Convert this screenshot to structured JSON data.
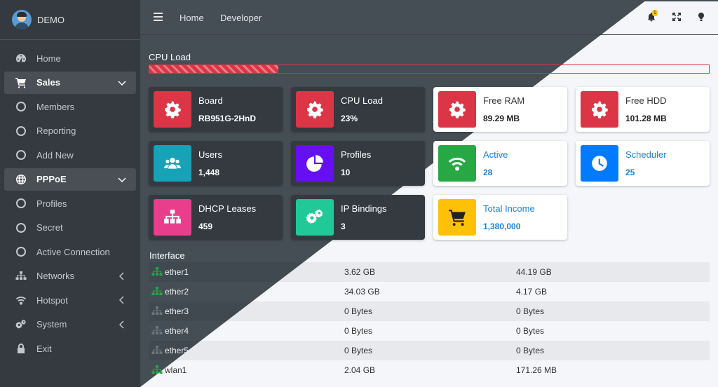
{
  "brand": {
    "name": "DEMO"
  },
  "sidebar": {
    "items": [
      {
        "label": "Home",
        "icon": "dashboard-icon"
      },
      {
        "label": "Sales",
        "icon": "cart-icon",
        "active": true
      },
      {
        "label": "Members",
        "icon": "circle-icon"
      },
      {
        "label": "Reporting",
        "icon": "circle-icon"
      },
      {
        "label": "Add New",
        "icon": "circle-icon"
      },
      {
        "label": "PPPoE",
        "icon": "globe-icon",
        "active": true
      },
      {
        "label": "Profiles",
        "icon": "circle-icon"
      },
      {
        "label": "Secret",
        "icon": "circle-icon"
      },
      {
        "label": "Active Connection",
        "icon": "circle-icon"
      },
      {
        "label": "Networks",
        "icon": "sitemap-icon"
      },
      {
        "label": "Hotspot",
        "icon": "wifi-icon"
      },
      {
        "label": "System",
        "icon": "cogs-icon"
      },
      {
        "label": "Exit",
        "icon": "lock-icon"
      }
    ]
  },
  "header": {
    "links": [
      "Home",
      "Developer"
    ],
    "notification_count": "1"
  },
  "cpu": {
    "label": "CPU Load",
    "percent": 23
  },
  "cards": [
    {
      "title": "Board",
      "value": "RB951G-2HnD",
      "icon": "gear-icon",
      "color": "#dc3545"
    },
    {
      "title": "CPU Load",
      "value": "23%",
      "icon": "gear-icon",
      "color": "#dc3545"
    },
    {
      "title": "Free RAM",
      "value": "89.29 MB",
      "icon": "gear-icon",
      "color": "#dc3545"
    },
    {
      "title": "Free HDD",
      "value": "101.28 MB",
      "icon": "gear-icon",
      "color": "#dc3545"
    },
    {
      "title": "Users",
      "value": "1,448",
      "icon": "users-icon",
      "color": "#17a2b8"
    },
    {
      "title": "Profiles",
      "value": "10",
      "icon": "pie-chart-icon",
      "color": "#6610f2"
    },
    {
      "title": "Active",
      "value": "28",
      "icon": "wifi-icon",
      "color": "#28a745"
    },
    {
      "title": "Scheduler",
      "value": "25",
      "icon": "clock-icon",
      "color": "#007bff"
    },
    {
      "title": "DHCP Leases",
      "value": "459",
      "icon": "sitemap-icon",
      "color": "#e83e8c"
    },
    {
      "title": "IP Bindings",
      "value": "3",
      "icon": "cogs-icon",
      "color": "#20c997"
    },
    {
      "title": "Total Income",
      "value": "1,380,000",
      "icon": "cart-icon",
      "color": "#ffc107"
    }
  ],
  "interface": {
    "title": "Interface",
    "rows": [
      {
        "name": "ether1",
        "rx": "3.62 GB",
        "tx": "44.19 GB",
        "status_color": "#28a745"
      },
      {
        "name": "ether2",
        "rx": "34.03 GB",
        "tx": "4.17 GB",
        "status_color": "#28a745"
      },
      {
        "name": "ether3",
        "rx": "0 Bytes",
        "tx": "0 Bytes",
        "status_color": "#6c757d"
      },
      {
        "name": "ether4",
        "rx": "0 Bytes",
        "tx": "0 Bytes",
        "status_color": "#6c757d"
      },
      {
        "name": "ether5",
        "rx": "0 Bytes",
        "tx": "0 Bytes",
        "status_color": "#6c757d"
      },
      {
        "name": "wlan1",
        "rx": "2.04 GB",
        "tx": "171.26 MB",
        "status_color": "#28a745"
      }
    ]
  }
}
